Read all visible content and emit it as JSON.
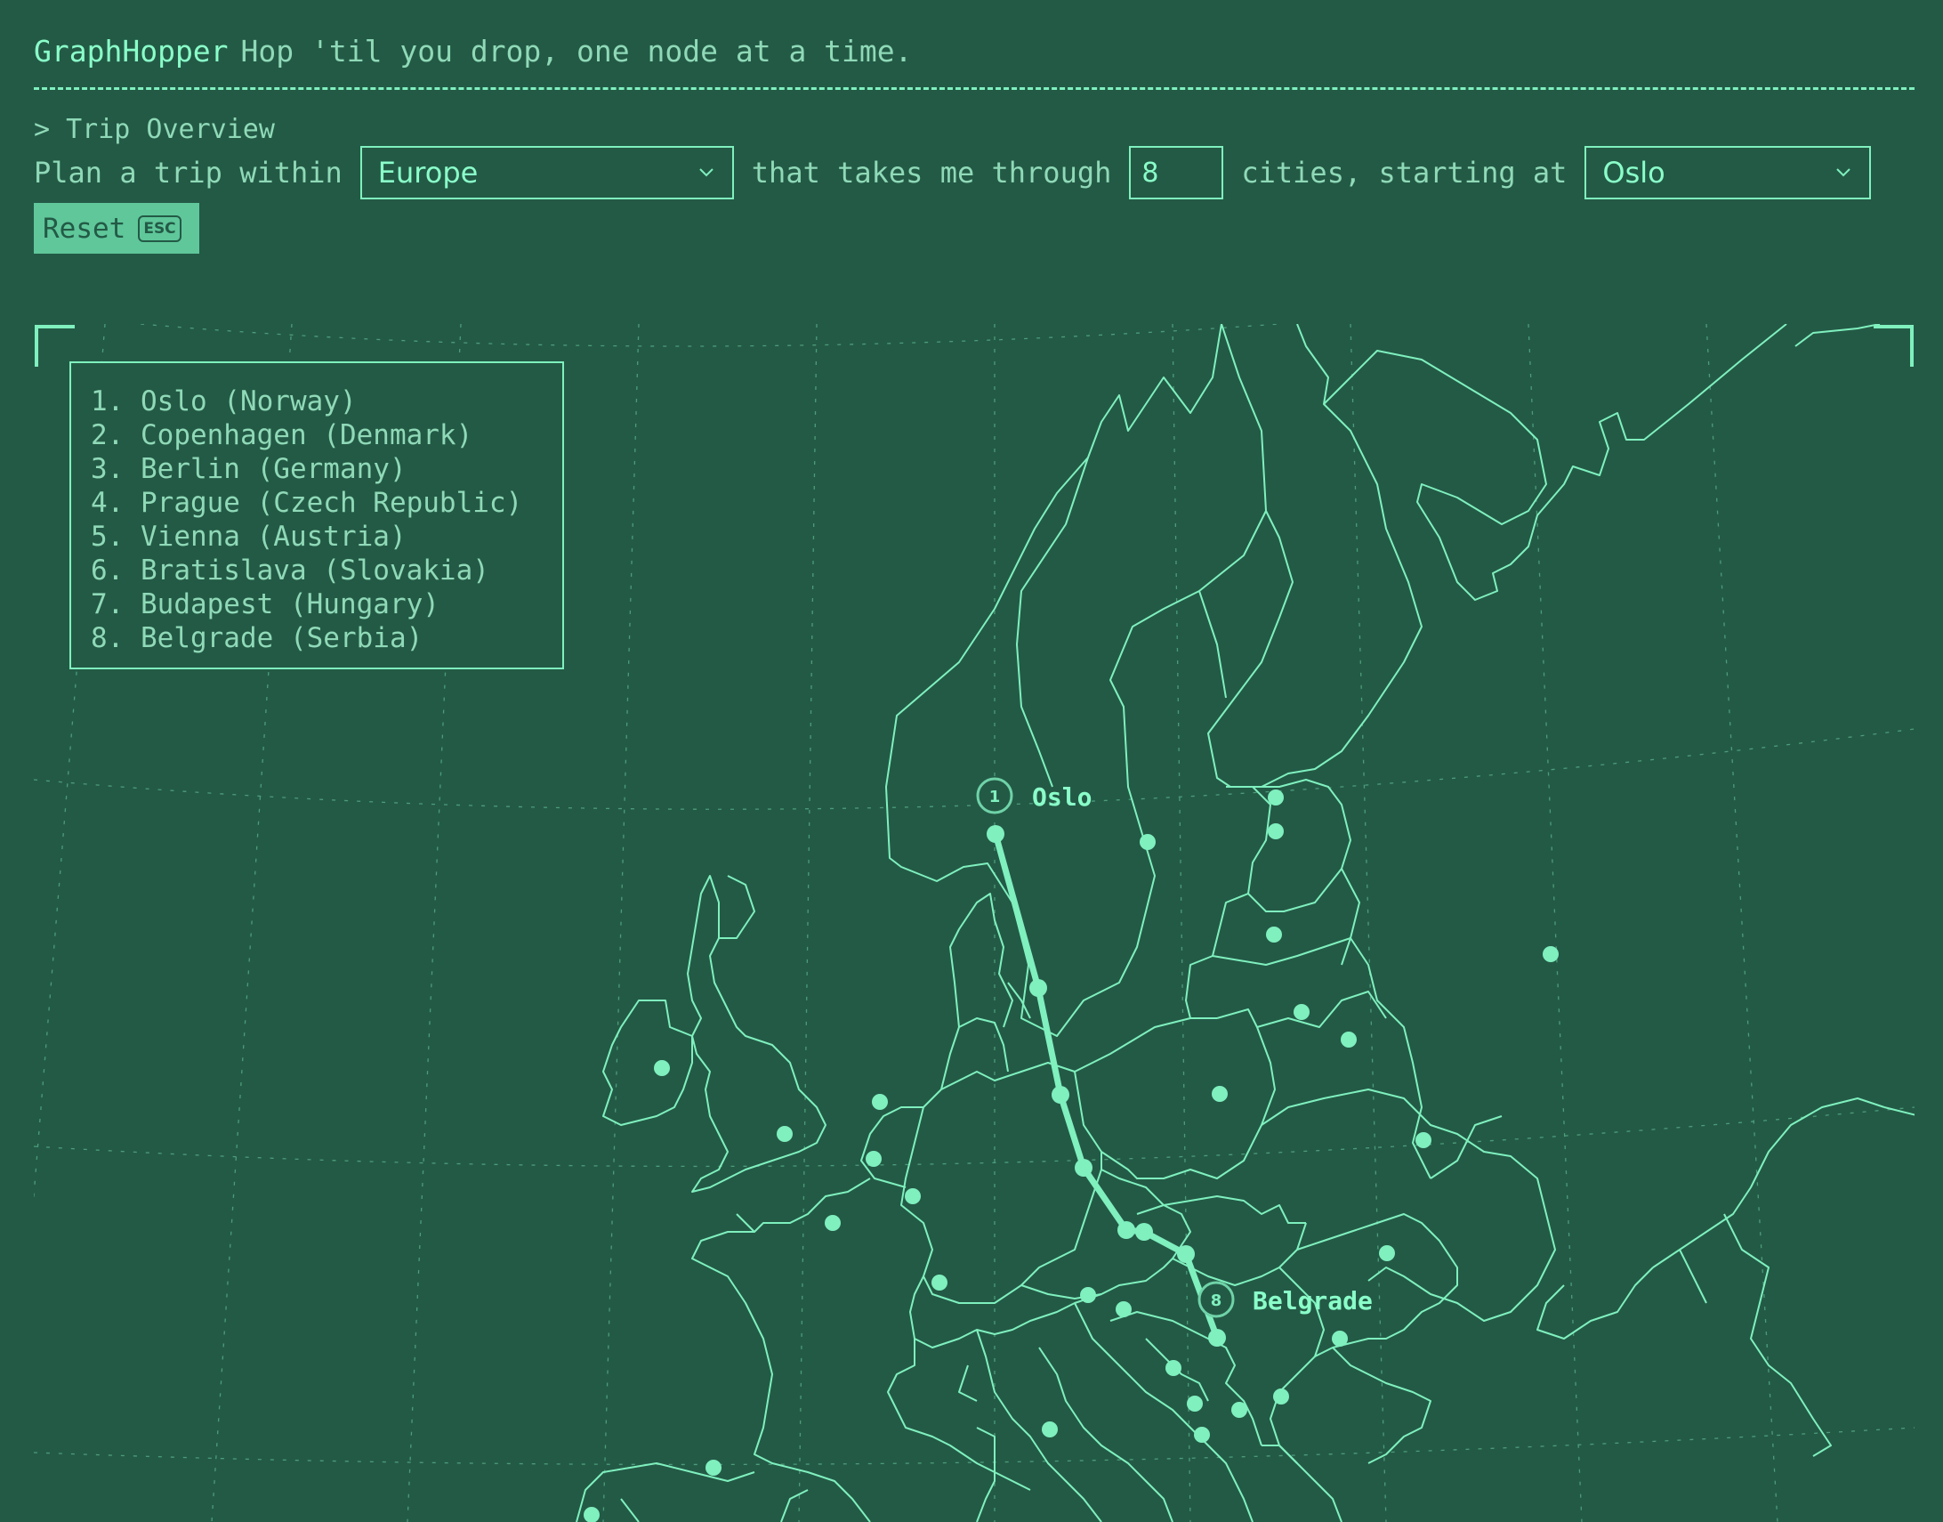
{
  "header": {
    "brand": "GraphHopper",
    "tagline": "Hop 'til you drop, one node at a time."
  },
  "section_title": "> Trip Overview",
  "controls": {
    "prefix": "Plan a trip within",
    "region_value": "Europe",
    "middle": "that takes me through",
    "city_count": "8",
    "suffix": "cities, starting at",
    "start_city_value": "Oslo"
  },
  "reset": {
    "label": "Reset",
    "shortcut": "ESC"
  },
  "trip": {
    "stops": [
      "1. Oslo (Norway)",
      "2. Copenhagen (Denmark)",
      "3. Berlin (Germany)",
      "4. Prague (Czech Republic)",
      "5. Vienna (Austria)",
      "6. Bratislava (Slovakia)",
      "7. Budapest (Hungary)",
      "8. Belgrade (Serbia)"
    ]
  },
  "map": {
    "start_marker": "1",
    "start_label": "Oslo",
    "end_marker": "8",
    "end_label": "Belgrade"
  },
  "colors": {
    "background": "#235a46",
    "accent": "#7ff0be",
    "route": "#7ff0be"
  }
}
